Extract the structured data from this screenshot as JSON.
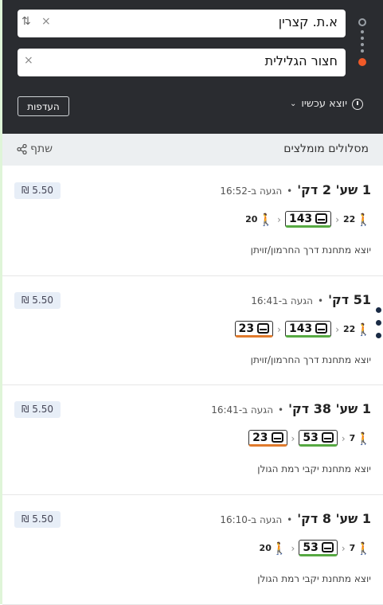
{
  "search": {
    "origin_value": "א.ת. קצרין",
    "destination_value": "חצור הגלילית",
    "clear_icon": "×",
    "swap_icon": "⇅",
    "depart_label": "יוצא עכשיו",
    "preferences_label": "העדפות",
    "colors": {
      "header_bg": "#2a2c30",
      "destination_dot": "#f05a28"
    }
  },
  "results": {
    "title": "מסלולים מומלצים",
    "share_label": "שתף"
  },
  "itineraries": [
    {
      "duration": "1 שע' 2 דק'",
      "arrival": "הגעה ב-16:52",
      "price": "₪ 5.50",
      "walk_start": "22",
      "buses": [
        {
          "number": "143",
          "color": "#56a942"
        }
      ],
      "walk_end": "20",
      "departs_from": "יוצא מתחנת דרך החרמון/זויתן"
    },
    {
      "duration": "51 דק'",
      "arrival": "הגעה ב-16:41",
      "price": "₪ 5.50",
      "walk_start": "22",
      "buses": [
        {
          "number": "143",
          "color": "#56a942"
        },
        {
          "number": "23",
          "color": "#e07a2c"
        }
      ],
      "walk_end": "",
      "departs_from": "יוצא מתחנת דרך החרמון/זויתן"
    },
    {
      "duration": "1 שע' 38 דק'",
      "arrival": "הגעה ב-16:41",
      "price": "₪ 5.50",
      "walk_start": "7",
      "buses": [
        {
          "number": "53",
          "color": "#56a942"
        },
        {
          "number": "23",
          "color": "#e07a2c"
        }
      ],
      "walk_end": "",
      "departs_from": "יוצא מתחנת יקבי רמת הגולן"
    },
    {
      "duration": "1 שע' 8 דק'",
      "arrival": "הגעה ב-16:10",
      "price": "₪ 5.50",
      "walk_start": "7",
      "buses": [
        {
          "number": "53",
          "color": "#56a942"
        }
      ],
      "walk_end": "20",
      "departs_from": "יוצא מתחנת יקבי רמת הגולן"
    }
  ]
}
